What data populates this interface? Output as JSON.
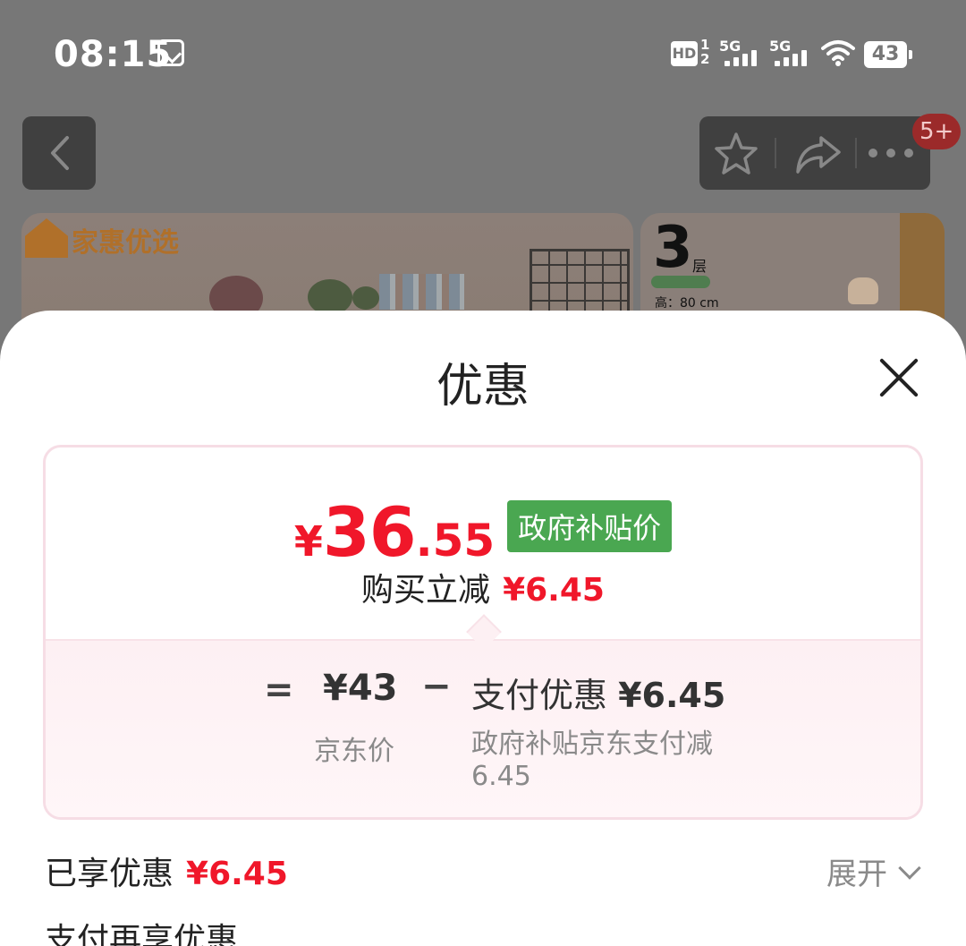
{
  "status_bar": {
    "time": "08:15",
    "hd_label": "HD",
    "hd_sub": "1\n2",
    "network_1": "5G",
    "network_2": "5G",
    "battery": "43"
  },
  "nav": {
    "back_icon": "chevron-left-icon",
    "favorite_icon": "star-icon",
    "share_icon": "share-arrow-icon",
    "more_icon": "more-dots-icon",
    "badge": "5+"
  },
  "product_banner": {
    "brand": "家惠优选",
    "side_number": "3",
    "side_unit": "层",
    "side_dim": "高：80 cm"
  },
  "sheet": {
    "title": "优惠",
    "close_icon": "close-icon",
    "price": {
      "yen": "¥",
      "integer": "36",
      "decimal": ".55",
      "tag": "政府补贴价"
    },
    "reduce": {
      "label": "购买立减",
      "amount": "¥6.45"
    },
    "breakdown": {
      "equals": "=",
      "jd_price": "¥43",
      "minus": "−",
      "pay_discount_label": "支付优惠",
      "pay_discount_value": "¥6.45",
      "jd_price_label": "京东价",
      "pay_discount_desc": "政府补贴京东支付减6.45"
    },
    "enjoyed": {
      "label": "已享优惠",
      "amount": "¥6.45",
      "expand_label": "展开"
    },
    "pay_more_label": "支付再享优惠"
  },
  "colors": {
    "accent_red": "#f0172a",
    "gov_green": "#4aa751",
    "card_border": "#f6dde5"
  }
}
